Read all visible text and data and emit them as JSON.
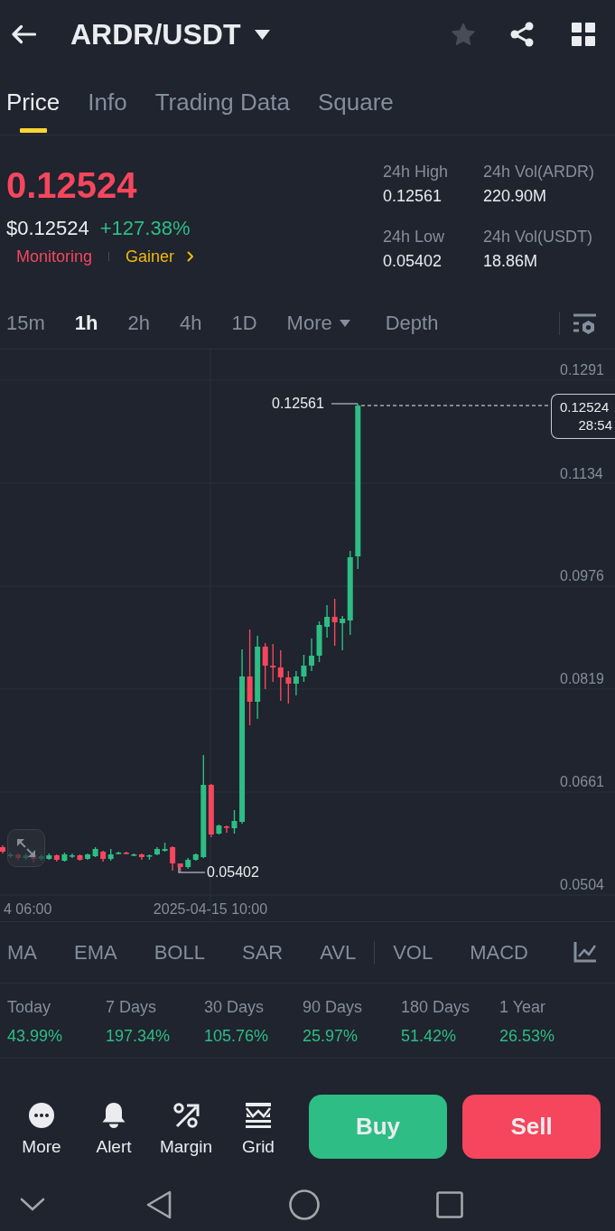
{
  "header": {
    "title": "ARDR/USDT",
    "favorite": false
  },
  "tabs": [
    {
      "label": "Price",
      "selected": true
    },
    {
      "label": "Info",
      "selected": false
    },
    {
      "label": "Trading Data",
      "selected": false
    },
    {
      "label": "Square",
      "selected": false
    }
  ],
  "ticker": {
    "price": "0.12524",
    "rising": false,
    "fiat_price": "$0.12524",
    "change": "+127.38%",
    "tags": [
      {
        "label": "Monitoring",
        "color": "#f6465d"
      },
      {
        "label": "Gainer",
        "color": "#f0b90b"
      }
    ]
  },
  "stats": [
    {
      "label": "24h High",
      "value": "0.12561"
    },
    {
      "label": "24h Vol(ARDR)",
      "value": "220.90M"
    },
    {
      "label": "24h Low",
      "value": "0.05402"
    },
    {
      "label": "24h Vol(USDT)",
      "value": "18.86M"
    }
  ],
  "intervals": [
    {
      "label": "15m",
      "selected": false
    },
    {
      "label": "1h",
      "selected": true
    },
    {
      "label": "2h",
      "selected": false
    },
    {
      "label": "4h",
      "selected": false
    },
    {
      "label": "1D",
      "selected": false
    }
  ],
  "more_menu": {
    "label": "More"
  },
  "depth_tab": {
    "label": "Depth",
    "selected": false
  },
  "chart": {
    "price_axis": [
      "0.1291",
      "0.1134",
      "0.0976",
      "0.0819",
      "0.0661",
      "0.0504"
    ],
    "time_axis": [
      "4 06:00",
      "2025-04-15 10:00"
    ],
    "high_label": "0.12561",
    "low_label": "0.05402",
    "last_price": "0.12524",
    "countdown": "28:54"
  },
  "indicators": {
    "main": [
      {
        "label": "MA",
        "selected": false
      },
      {
        "label": "EMA",
        "selected": false
      },
      {
        "label": "BOLL",
        "selected": false
      },
      {
        "label": "SAR",
        "selected": false
      },
      {
        "label": "AVL",
        "selected": false
      }
    ],
    "sub": [
      {
        "label": "VOL",
        "selected": false
      },
      {
        "label": "MACD",
        "selected": false
      }
    ]
  },
  "performance": [
    {
      "label": "Today",
      "value": "43.99%"
    },
    {
      "label": "7 Days",
      "value": "197.34%"
    },
    {
      "label": "30 Days",
      "value": "105.76%"
    },
    {
      "label": "90 Days",
      "value": "25.97%"
    },
    {
      "label": "180 Days",
      "value": "51.42%"
    },
    {
      "label": "1 Year",
      "value": "26.53%"
    }
  ],
  "actions": [
    {
      "label": "More"
    },
    {
      "label": "Alert"
    },
    {
      "label": "Margin"
    },
    {
      "label": "Grid"
    }
  ],
  "trade_buttons": [
    {
      "label": "Buy",
      "kind": "buy"
    },
    {
      "label": "Sell",
      "kind": "sell"
    }
  ]
}
